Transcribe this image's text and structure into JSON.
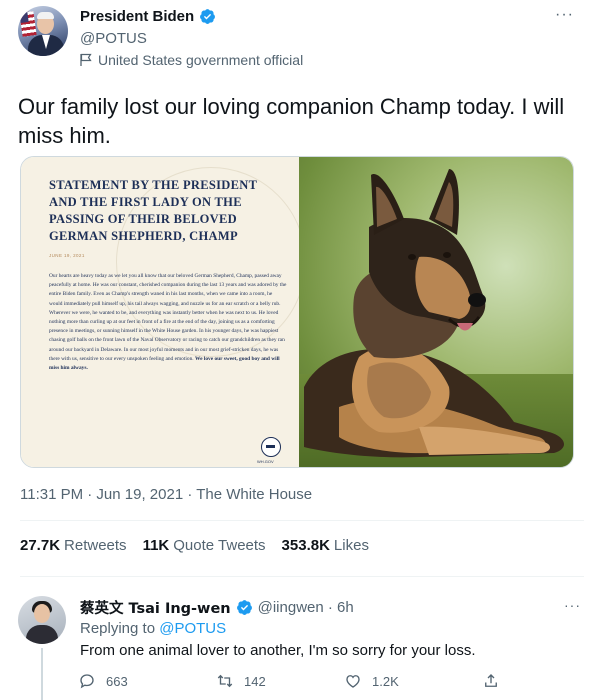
{
  "main_tweet": {
    "author": {
      "display_name": "President Biden",
      "handle": "@POTUS",
      "gov_label": "United States government official"
    },
    "text": "Our family lost our loving companion Champ today. I will miss him.",
    "statement_image": {
      "title": "Statement by the President and the First Lady on the Passing of their Beloved German Shepherd, Champ",
      "date": "JUNE 19, 2021",
      "body_plain": "Our hearts are heavy today as we let you all know that our beloved German Shepherd, Champ, passed away peacefully at home. He was our constant, cherished companion during the last 13 years and was adored by the entire Biden family. Even as Champ's strength waned in his last months, when we came into a room, he would immediately pull himself up, his tail always wagging, and nuzzle us for an ear scratch or a belly rub. Wherever we were, he wanted to be, and everything was instantly better when he was next to us. He loved nothing more than curling up at our feet in front of a fire at the end of the day, joining us as a comforting presence in meetings, or sunning himself in the White House garden. In his younger days, he was happiest chasing golf balls on the front lawn of the Naval Observatory or racing to catch our grandchildren as they ran around our backyard in Delaware. In our most joyful moments and in our most grief-stricken days, he was there with us, sensitive to our every unspoken feeling and emotion.",
      "body_bold": "We love our sweet, good boy and will miss him always.",
      "site": "WH.GOV"
    },
    "timestamp": "11:31 PM · Jun 19, 2021 · The White House",
    "stats": {
      "retweets_count": "27.7K",
      "retweets_label": "Retweets",
      "quotes_count": "11K",
      "quotes_label": "Quote Tweets",
      "likes_count": "353.8K",
      "likes_label": "Likes"
    }
  },
  "reply": {
    "display_name": "蔡英文 Tsai Ing-wen",
    "handle_time": "@iingwen · 6h",
    "replying_prefix": "Replying to",
    "replying_mention": "@POTUS",
    "text": "From one animal lover to another, I'm so sorry for your loss.",
    "actions": {
      "reply_count": "663",
      "retweet_count": "142",
      "like_count": "1.2K"
    }
  },
  "colors": {
    "verified": "#1d9bf0",
    "secondary_text": "#536471",
    "statement_navy": "#1d2f57"
  }
}
